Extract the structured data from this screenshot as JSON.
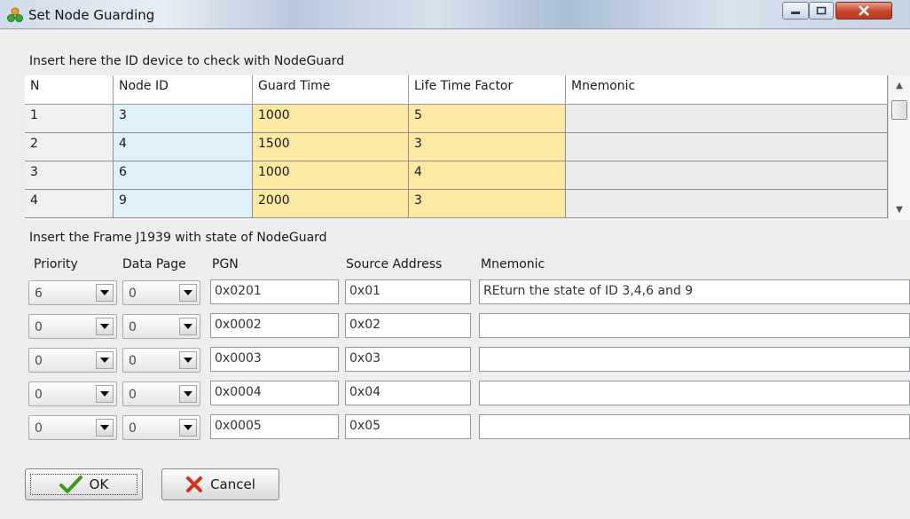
{
  "window": {
    "title": "Set Node Guarding",
    "app_icon": "nodes-icon",
    "controls": {
      "minimize": "minimize-icon",
      "maximize": "maximize-icon",
      "close": "close-icon"
    }
  },
  "grid_section": {
    "label": "Insert here the ID device to check with NodeGuard",
    "columns": [
      "N",
      "Node ID",
      "Guard Time",
      "Life Time Factor",
      "Mnemonic"
    ],
    "rows": [
      {
        "n": "1",
        "node_id": "3",
        "guard_time": "1000",
        "life_time_factor": "5",
        "mnemonic": ""
      },
      {
        "n": "2",
        "node_id": "4",
        "guard_time": "1500",
        "life_time_factor": "3",
        "mnemonic": ""
      },
      {
        "n": "3",
        "node_id": "6",
        "guard_time": "1000",
        "life_time_factor": "4",
        "mnemonic": ""
      },
      {
        "n": "4",
        "node_id": "9",
        "guard_time": "2000",
        "life_time_factor": "3",
        "mnemonic": ""
      }
    ],
    "scroll": {
      "up": "▲",
      "down": "▼"
    }
  },
  "frame_section": {
    "label": "Insert the Frame J1939 with state of NodeGuard",
    "headers": {
      "priority": "Priority",
      "data_page": "Data Page",
      "pgn": "PGN",
      "source_address": "Source Address",
      "mnemonic": "Mnemonic"
    },
    "rows": [
      {
        "priority": "6",
        "data_page": "0",
        "pgn": "0x0201",
        "source_address": "0x01",
        "mnemonic": "REturn the state of ID 3,4,6 and 9"
      },
      {
        "priority": "0",
        "data_page": "0",
        "pgn": "0x0002",
        "source_address": "0x02",
        "mnemonic": ""
      },
      {
        "priority": "0",
        "data_page": "0",
        "pgn": "0x0003",
        "source_address": "0x03",
        "mnemonic": ""
      },
      {
        "priority": "0",
        "data_page": "0",
        "pgn": "0x0004",
        "source_address": "0x04",
        "mnemonic": ""
      },
      {
        "priority": "0",
        "data_page": "0",
        "pgn": "0x0005",
        "source_address": "0x05",
        "mnemonic": ""
      }
    ]
  },
  "buttons": {
    "ok": "OK",
    "cancel": "Cancel"
  },
  "colors": {
    "node_id_cell": "#dff2fb",
    "time_cell": "#fbe9a4",
    "ok_check": "#3f9a1c",
    "cancel_x": "#d0321a"
  }
}
